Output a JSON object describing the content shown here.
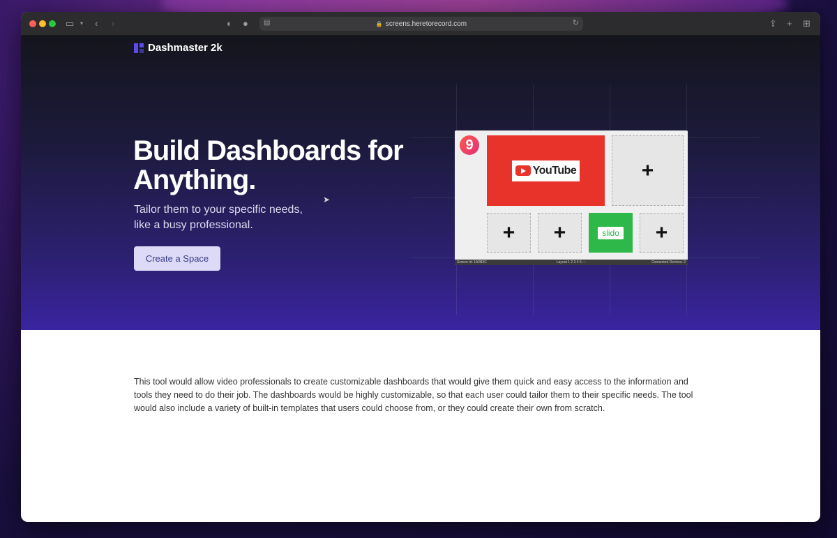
{
  "browser": {
    "url": "screens.heretorecord.com"
  },
  "site": {
    "brand": "Dashmaster 2k"
  },
  "hero": {
    "headline": "Build Dashboards for Anything.",
    "subhead": "Tailor them to your specific needs, like a busy professional.",
    "cta_label": "Create a Space"
  },
  "preview": {
    "app_logo": "9",
    "youtube_label": "YouTube",
    "slido_label": "slido",
    "add_glyph": "+",
    "status_left": "Screen Id: 1A2B3C",
    "status_mid": "Layout  1  2  3  4  5  —",
    "status_right": "Connected Devices: 2"
  },
  "body": {
    "paragraph": "This tool would allow video professionals to create customizable dashboards that would give them quick and easy access to the information and tools they need to do their job. The dashboards would be highly customizable, so that each user could tailor them to their specific needs. The tool would also include a variety of built-in templates that users could choose from, or they could create their own from scratch."
  },
  "colors": {
    "brand_accent": "#5a4af0",
    "cta_bg": "#dcdaf6",
    "youtube_red": "#e8332a",
    "slido_green": "#2fb84a"
  },
  "icons": {
    "toolbar": [
      "sidebar-icon",
      "chevron-down-icon",
      "back-icon",
      "forward-icon",
      "shield-icon",
      "extension-icon",
      "reader-icon",
      "lock-icon",
      "reload-icon",
      "share-icon",
      "new-tab-icon",
      "tab-overview-icon"
    ]
  }
}
